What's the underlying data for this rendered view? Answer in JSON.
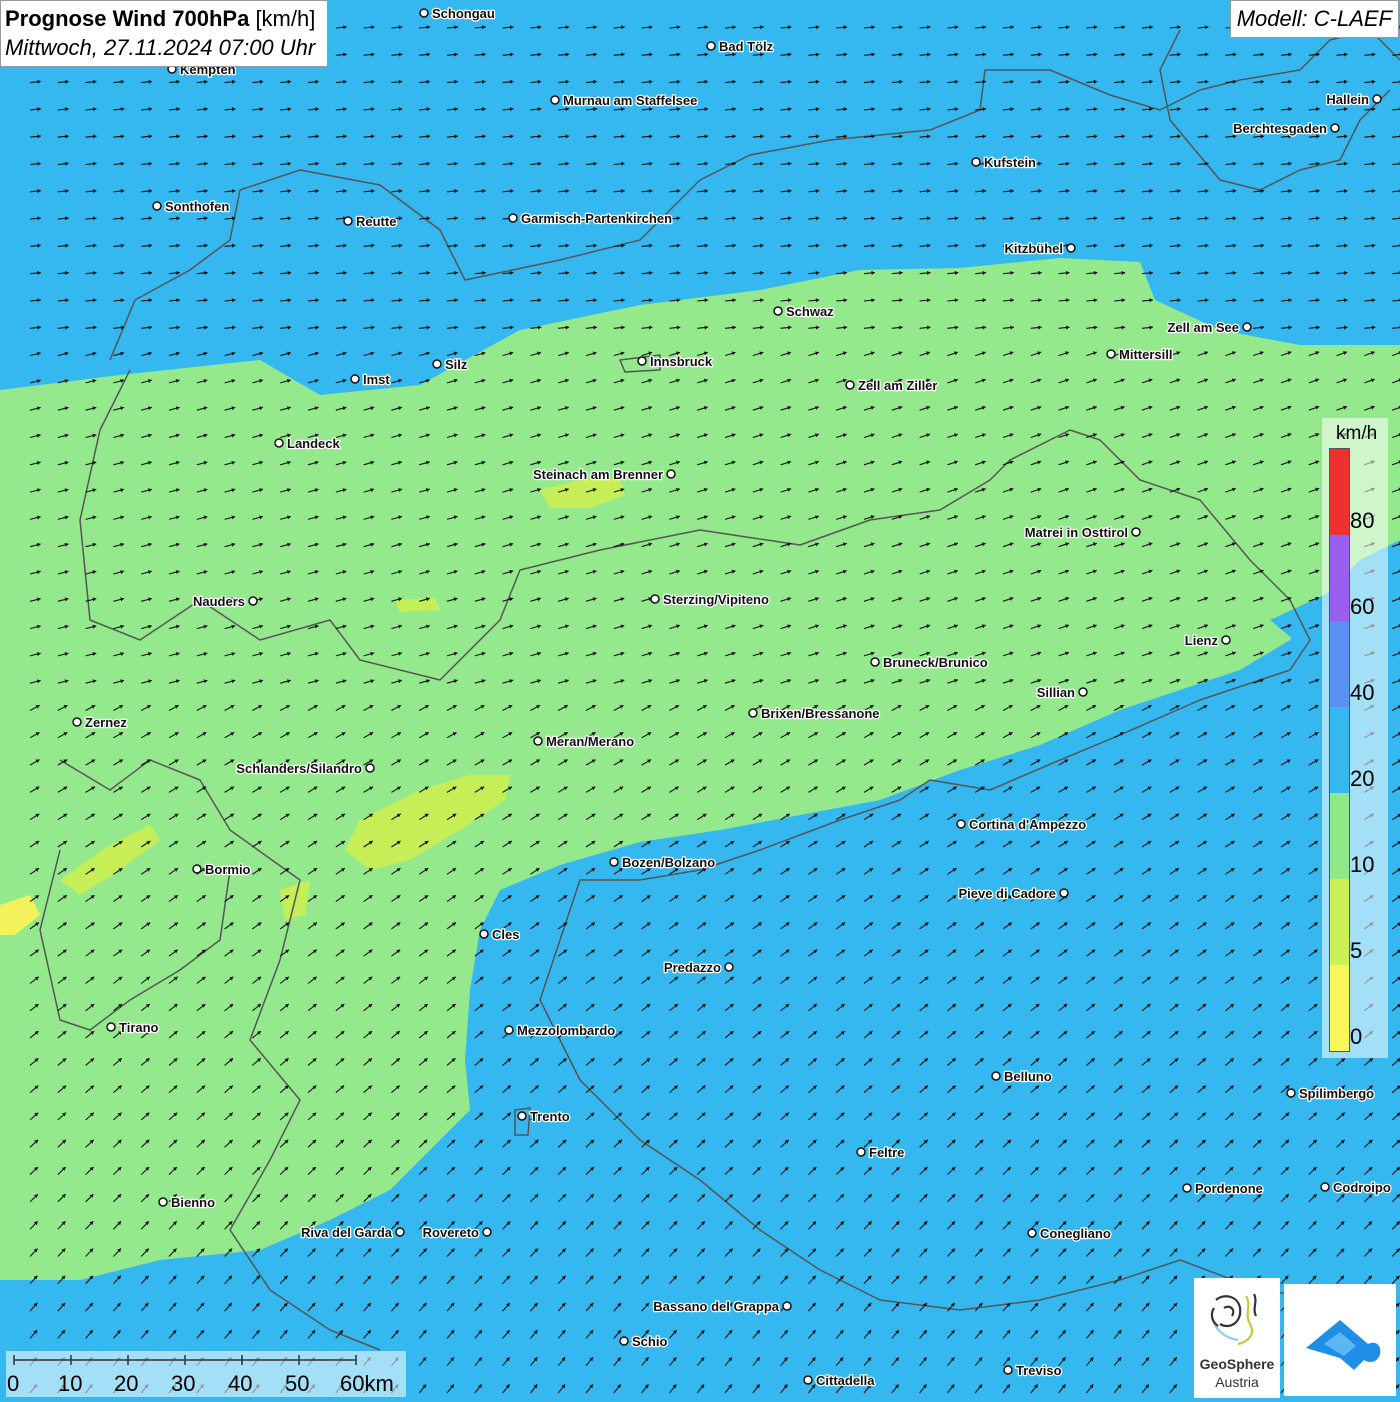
{
  "header": {
    "title_bold": "Prognose Wind 700hPa",
    "title_unit": "[km/h]",
    "subtitle": "Mittwoch, 27.11.2024 07:00 Uhr",
    "model": "Modell: C-LAEF"
  },
  "cities": [
    {
      "name": "Schongau"
    },
    {
      "name": "Bad Tölz"
    },
    {
      "name": "Kempten"
    },
    {
      "name": "Murnau am Staffelsee"
    },
    {
      "name": "Hallein"
    },
    {
      "name": "Berchtesgaden"
    },
    {
      "name": "Kufstein"
    },
    {
      "name": "Sonthofen"
    },
    {
      "name": "Reutte"
    },
    {
      "name": "Garmisch-Partenkirchen"
    },
    {
      "name": "Kitzbühel"
    },
    {
      "name": "Schwaz"
    },
    {
      "name": "Zell am See"
    },
    {
      "name": "Innsbruck"
    },
    {
      "name": "Mittersill"
    },
    {
      "name": "Imst"
    },
    {
      "name": "Silz"
    },
    {
      "name": "Zell am Ziller"
    },
    {
      "name": "Landeck"
    },
    {
      "name": "Steinach am Brenner"
    },
    {
      "name": "Matrei in Osttirol"
    },
    {
      "name": "Nauders"
    },
    {
      "name": "Sterzing/Vipiteno"
    },
    {
      "name": "Lienz"
    },
    {
      "name": "Bruneck/Brunico"
    },
    {
      "name": "Sillian"
    },
    {
      "name": "Zernez"
    },
    {
      "name": "Brixen/Bressanone"
    },
    {
      "name": "Meran/Merano"
    },
    {
      "name": "Schlanders/Silandro"
    },
    {
      "name": "Cortina d'Ampezzo"
    },
    {
      "name": "Bozen/Bolzano"
    },
    {
      "name": "Bormio"
    },
    {
      "name": "Pieve di Cadore"
    },
    {
      "name": "Cles"
    },
    {
      "name": "Predazzo"
    },
    {
      "name": "Tirano"
    },
    {
      "name": "Mezzolombardo"
    },
    {
      "name": "Belluno"
    },
    {
      "name": "Spilimbergo"
    },
    {
      "name": "Trento"
    },
    {
      "name": "Feltre"
    },
    {
      "name": "Pordenone"
    },
    {
      "name": "Codroipo"
    },
    {
      "name": "Bienno"
    },
    {
      "name": "Riva del Garda"
    },
    {
      "name": "Rovereto"
    },
    {
      "name": "Conegliano"
    },
    {
      "name": "Bassano del Grappa"
    },
    {
      "name": "Schio"
    },
    {
      "name": "Treviso"
    },
    {
      "name": "Cittadella"
    }
  ],
  "legend": {
    "unit": "km/h",
    "ticks": [
      "80",
      "60",
      "40",
      "20",
      "10",
      "5",
      "0"
    ],
    "colors": [
      "#ee3030",
      "#9a5ef0",
      "#5b8ff0",
      "#35b8f0",
      "#8fe88a",
      "#ccf055",
      "#f8f75a"
    ],
    "band_colors": {
      "calm": "#f3f25a",
      "light": "#c6ef57",
      "moderate": "#95e98d",
      "fresh": "#35b8f0"
    }
  },
  "scalebar": {
    "labels": [
      "0",
      "10",
      "20",
      "30",
      "40",
      "50",
      "60km"
    ]
  },
  "logo": {
    "name_line1": "GeoSphere",
    "name_line2": "Austria"
  }
}
